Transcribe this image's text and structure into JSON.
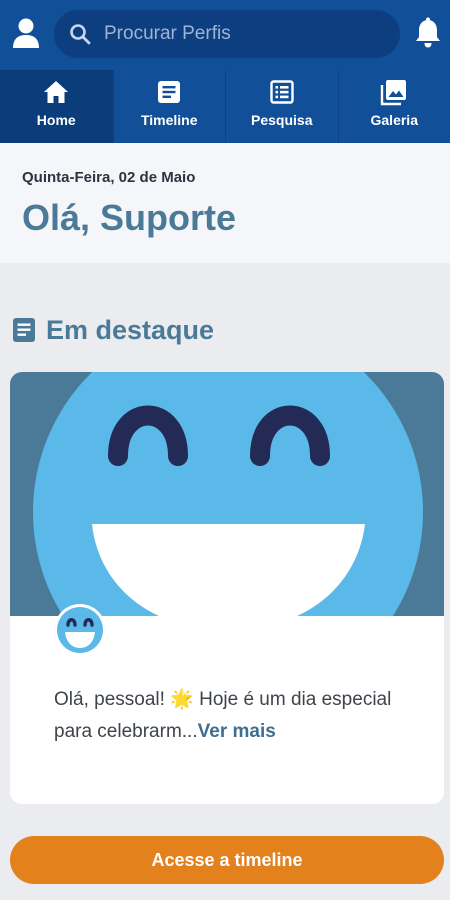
{
  "topbar": {
    "search_placeholder": "Procurar Perfis",
    "tabs": [
      {
        "label": "Home",
        "icon": "home-icon"
      },
      {
        "label": "Timeline",
        "icon": "document-icon"
      },
      {
        "label": "Pesquisa",
        "icon": "list-icon"
      },
      {
        "label": "Galeria",
        "icon": "gallery-icon"
      }
    ]
  },
  "greeting": {
    "date": "Quinta-Feira, 02 de Maio",
    "hello": "Olá, Suporte"
  },
  "featured": {
    "title": "Em destaque",
    "post_text": "Olá, pessoal! 🌟 Hoje é um dia especial para celebrarm...",
    "more_label": "Ver mais"
  },
  "cta": {
    "label": "Acesse a timeline"
  },
  "colors": {
    "header": "#124f99",
    "accent": "#4b7a98",
    "cta": "#e3811d"
  }
}
